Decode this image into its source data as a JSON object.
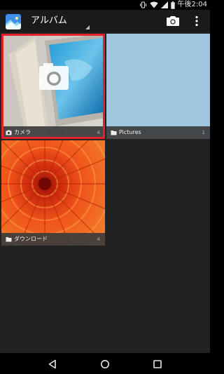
{
  "status_bar": {
    "time": "午後2:04",
    "icons": [
      "vibrate-icon",
      "wifi-icon",
      "signal-icon",
      "battery-icon"
    ]
  },
  "app_bar": {
    "title": "アルバム",
    "actions": [
      "camera-icon",
      "overflow-menu-icon"
    ]
  },
  "albums": [
    {
      "label": "カメラ",
      "count": "4",
      "icon": "camera-icon",
      "selected": true
    },
    {
      "label": "Pictures",
      "count": "1",
      "icon": "folder-icon",
      "selected": false
    },
    {
      "label": "ダウンロード",
      "count": "4",
      "icon": "folder-icon",
      "selected": false
    }
  ],
  "nav_bar": {
    "buttons": [
      "back-icon",
      "home-icon",
      "recents-icon"
    ]
  },
  "colors": {
    "status_bar": "#000000",
    "app_bar": "#1a1a1a",
    "grid_background": "#222222",
    "caption_background": "#3c3c3c",
    "selection_border": "#e3232b",
    "pictures_thumbnail": "#9fc6df",
    "nav_bar": "#000000"
  }
}
